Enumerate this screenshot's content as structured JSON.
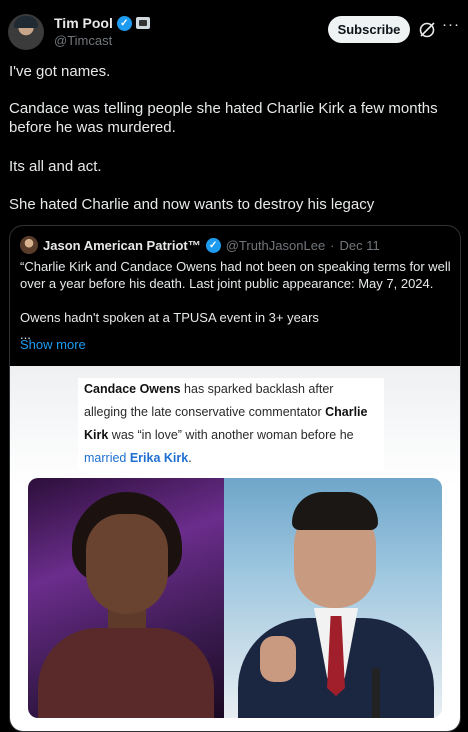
{
  "author": {
    "name": "Tim Pool",
    "handle": "@Timcast",
    "verified_mark": "✓"
  },
  "header": {
    "subscribe_label": "Subscribe",
    "more_label": "···"
  },
  "post": {
    "paragraphs": [
      "I've got names.",
      "Candace was telling people she hated Charlie Kirk a few months before he was murdered.",
      "Its all and act.",
      "She hated Charlie and now wants to destroy his legacy"
    ]
  },
  "quote": {
    "name": "Jason American Patriot™",
    "handle": "@TruthJasonLee",
    "separator": "·",
    "date": "Dec 11",
    "lines": [
      "“Charlie Kirk and Candace Owens had not been on speaking terms for well",
      "over a year before his death.  Last joint public appearance: May 7, 2024.",
      "",
      "Owens hadn't spoken at a TPUSA event in 3+ years",
      "..."
    ],
    "show_more": "Show more"
  },
  "media": {
    "headline_bold_1": "Candace Owens",
    "headline_text_1": " has sparked backlash after alleging the late conservative commentator ",
    "headline_bold_2": "Charlie Kirk",
    "headline_text_2": " was “in love” with another woman before he ",
    "headline_blue": "married ",
    "headline_blue_bold": "Erika Kirk",
    "headline_end": "."
  },
  "colors": {
    "background": "#000000",
    "text": "#e7e9ea",
    "muted": "#71767b",
    "link": "#1d9bf0"
  },
  "icons": {
    "verified": "verified-badge-icon",
    "affiliate": "affiliate-badge-icon",
    "grok": "grok-icon",
    "more": "more-options-icon"
  }
}
